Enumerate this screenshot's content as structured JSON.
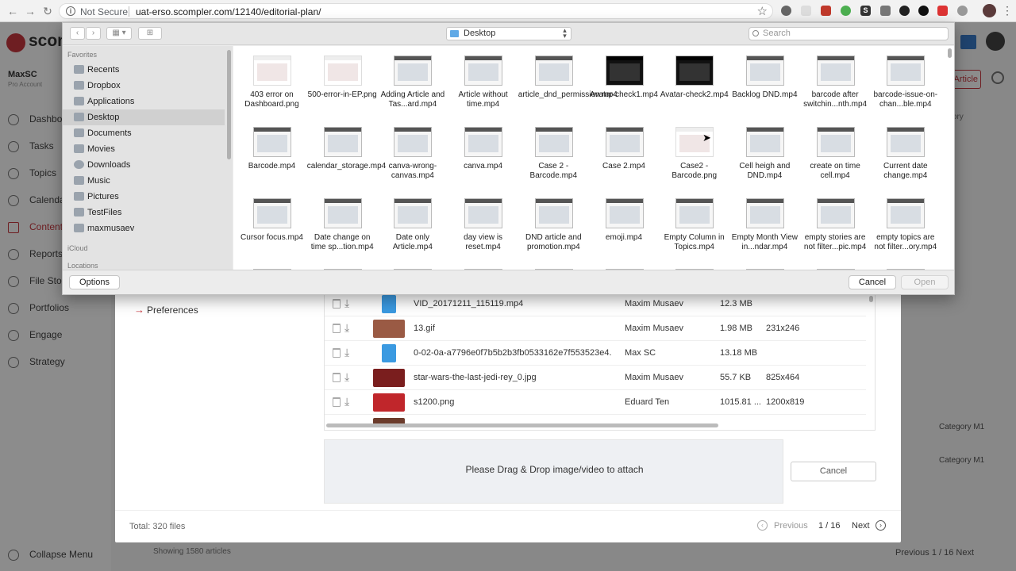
{
  "browser": {
    "security_label": "Not Secure",
    "url": "uat-erso.scompler.com/12140/editorial-plan/"
  },
  "app": {
    "brand": "scom",
    "account_name": "MaxSC",
    "account_plan": "Pro Account",
    "sidebar": [
      {
        "label": "Dashboa"
      },
      {
        "label": "Tasks"
      },
      {
        "label": "Topics"
      },
      {
        "label": "Calenda"
      },
      {
        "label": "Content"
      },
      {
        "label": "Reports"
      },
      {
        "label": "File Stor"
      },
      {
        "label": "Portfolios"
      },
      {
        "label": "Engage"
      },
      {
        "label": "Strategy"
      }
    ],
    "collapse_menu": "Collapse Menu",
    "new_button": "Article",
    "category_header": "tegory",
    "category_values": [
      "Category M1",
      "Category M1"
    ],
    "showing": "Showing  1580 articles",
    "pagination": "Previous     1 / 16     Next"
  },
  "modal": {
    "preferences": "Preferences",
    "rows": [
      {
        "name": "VID_20171211_115119.mp4",
        "owner": "Maxim Musaev",
        "size": "12.3 MB",
        "dims": ""
      },
      {
        "name": "13.gif",
        "owner": "Maxim Musaev",
        "size": "1.98 MB",
        "dims": "231x246"
      },
      {
        "name": "0-02-0a-a7796e0f7b5b2b3fb0533162e7f553523e4...",
        "owner": "Max SC",
        "size": "13.18 MB",
        "dims": ""
      },
      {
        "name": "star-wars-the-last-jedi-rey_0.jpg",
        "owner": "Maxim Musaev",
        "size": "55.7 KB",
        "dims": "825x464"
      },
      {
        "name": "s1200.png",
        "owner": "Eduard Ten",
        "size": "1015.81 ...",
        "dims": "1200x819"
      }
    ],
    "drop_text": "Please Drag & Drop image/video to attach",
    "cancel": "Cancel",
    "total": "Total: 320 files",
    "previous": "Previous",
    "page": "1 / 16",
    "next": "Next"
  },
  "dialog": {
    "location": "Desktop",
    "search_placeholder": "Search",
    "sidebar": {
      "favorites_header": "Favorites",
      "favorites": [
        "Recents",
        "Dropbox",
        "Applications",
        "Desktop",
        "Documents",
        "Movies",
        "Downloads",
        "Music",
        "Pictures",
        "TestFiles",
        "maxmusaev"
      ],
      "icloud_header": "iCloud",
      "locations_header": "Locations"
    },
    "files": [
      "403 error on Dashboard.png",
      "500-error-in-EP.png",
      "Adding Article and Tas...ard.mp4",
      "Article without time.mp4",
      "article_dnd_permission.mp4",
      "Avatar-check1.mp4",
      "Avatar-check2.mp4",
      "Backlog DND.mp4",
      "barcode after switchin...nth.mp4",
      "barcode-issue-on-chan...ble.mp4",
      "Barcode.mp4",
      "calendar_storage.mp4",
      "canva-wrong-canvas.mp4",
      "canva.mp4",
      "Case 2 - Barcode.mp4",
      "Case 2.mp4",
      "Case2 - Barcode.png",
      "Cell heigh and DND.mp4",
      "create on time cell.mp4",
      "Current date change.mp4",
      "Cursor focus.mp4",
      "Date change on time sp...tion.mp4",
      "Date only Article.mp4",
      "day view is reset.mp4",
      "DND article and promotion.mp4",
      "emoji.mp4",
      "Empty Column in Topics.mp4",
      "Empty Month View in...ndar.mp4",
      "empty stories are not filter...pic.mp4",
      "empty topics are not filter...ory.mp4"
    ],
    "options": "Options",
    "cancel": "Cancel",
    "open": "Open"
  }
}
